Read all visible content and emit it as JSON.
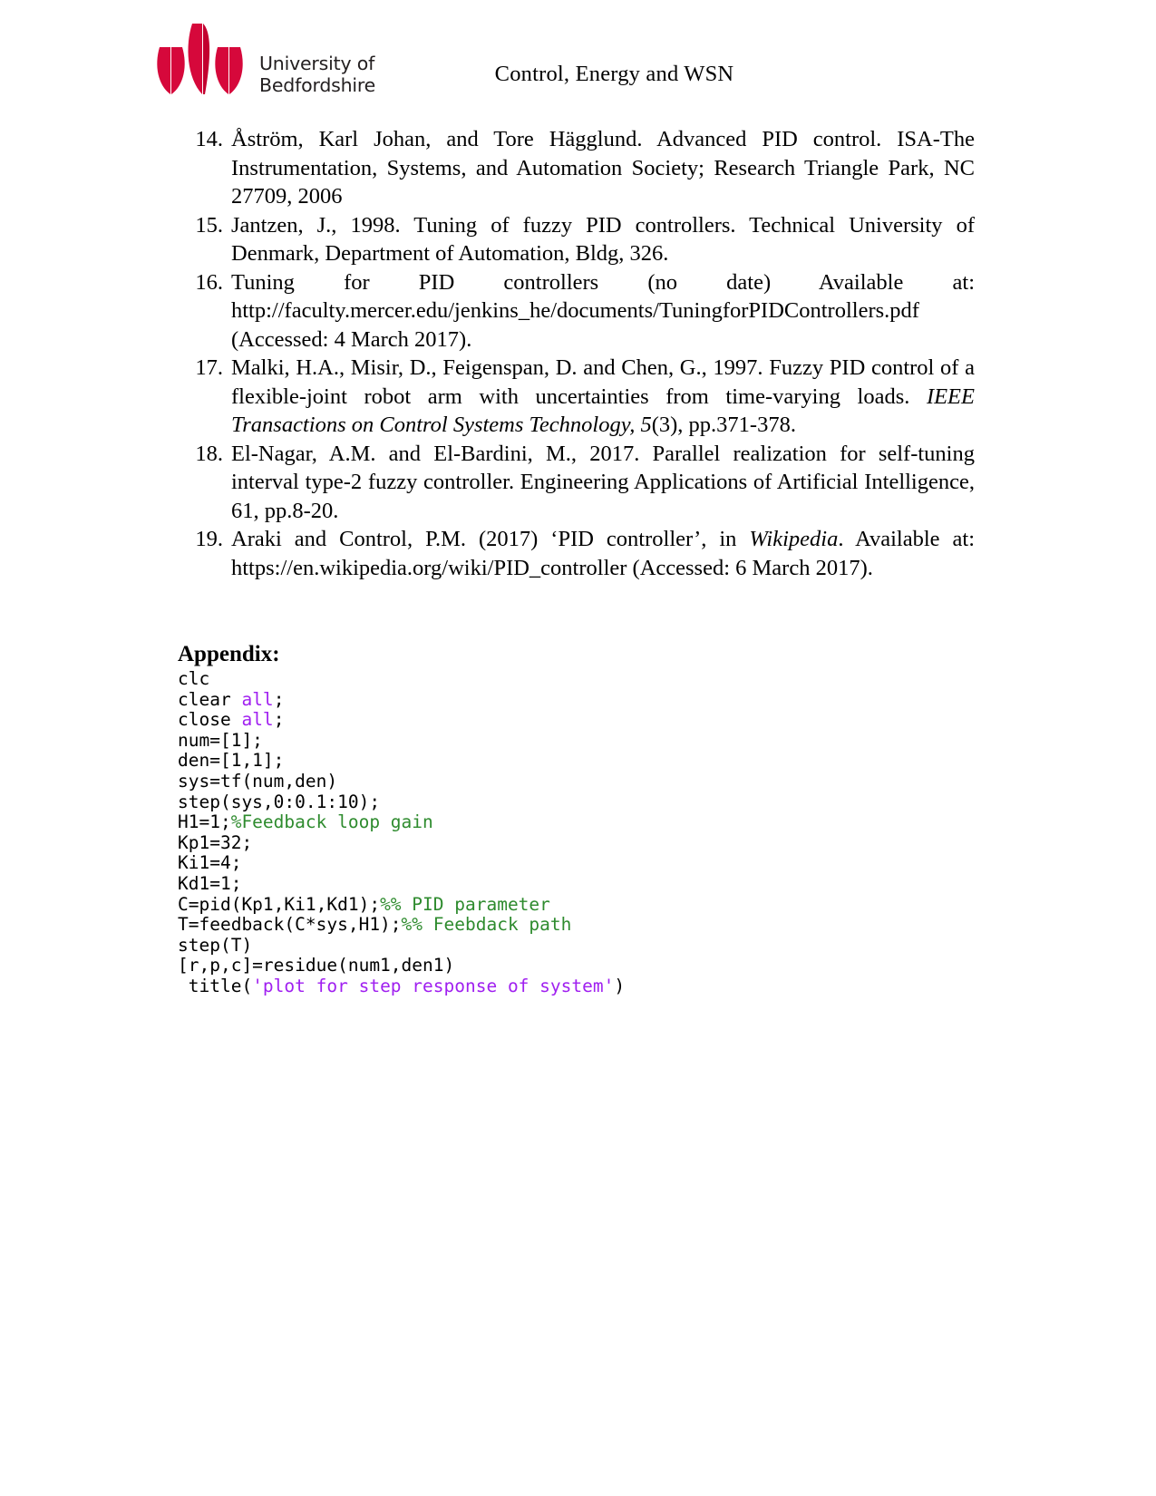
{
  "header": {
    "university_line1": "University of",
    "university_line2": "Bedfordshire",
    "logo_name": "university-of-bedfordshire-logo",
    "brand_color": "#d6083b",
    "document_title": "Control, Energy and WSN"
  },
  "references": [
    {
      "number": "14.",
      "text": "Åström, Karl Johan, and Tore Hägglund. Advanced PID control. ISA-The Instrumentation, Systems, and Automation Society; Research Triangle Park, NC 27709, 2006"
    },
    {
      "number": "15.",
      "text": "Jantzen, J., 1998. Tuning of fuzzy PID controllers. Technical University of Denmark, Department of Automation, Bldg, 326."
    },
    {
      "number": "16.",
      "text": "Tuning for PID controllers (no date) Available at: http://faculty.mercer.edu/jenkins_he/documents/TuningforPIDControllers.pdf (Accessed: 4 March 2017)."
    },
    {
      "number": "17.",
      "text_pre": "Malki, H.A., Misir, D., Feigenspan, D. and Chen, G., 1997. Fuzzy PID control of a flexible-joint robot arm with uncertainties from time-varying loads. ",
      "text_italic": "IEEE Transactions on Control Systems Technology, 5",
      "text_post": "(3), pp.371-378."
    },
    {
      "number": "18.",
      "text": "El-Nagar, A.M. and El-Bardini, M., 2017. Parallel realization for self-tuning interval type-2 fuzzy controller. Engineering Applications of Artificial Intelligence, 61, pp.8-20."
    },
    {
      "number": "19.",
      "text_pre": "Araki and Control, P.M. (2017) ‘PID controller’, in ",
      "text_italic": "Wikipedia",
      "text_post": ". Available at: https://en.wikipedia.org/wiki/PID_controller (Accessed: 6 March 2017)."
    }
  ],
  "appendix": {
    "title": "Appendix:",
    "colors": {
      "keyword": "#a020f0",
      "comment": "#2e8b2e",
      "string": "#a020f0",
      "plain": "#000000"
    },
    "code_lines": [
      [
        {
          "t": "clc",
          "c": "plain"
        }
      ],
      [
        {
          "t": "clear ",
          "c": "plain"
        },
        {
          "t": "all",
          "c": "kw"
        },
        {
          "t": ";",
          "c": "plain"
        }
      ],
      [
        {
          "t": "close ",
          "c": "plain"
        },
        {
          "t": "all",
          "c": "kw"
        },
        {
          "t": ";",
          "c": "plain"
        }
      ],
      [
        {
          "t": "num=[1];",
          "c": "plain"
        }
      ],
      [
        {
          "t": "den=[1,1];",
          "c": "plain"
        }
      ],
      [
        {
          "t": "sys=tf(num,den)",
          "c": "plain"
        }
      ],
      [
        {
          "t": "step(sys,0:0.1:10);",
          "c": "plain"
        }
      ],
      [
        {
          "t": "H1=1;",
          "c": "plain"
        },
        {
          "t": "%Feedback loop gain",
          "c": "cmt"
        }
      ],
      [
        {
          "t": "Kp1=32;",
          "c": "plain"
        }
      ],
      [
        {
          "t": "Ki1=4;",
          "c": "plain"
        }
      ],
      [
        {
          "t": "Kd1=1;",
          "c": "plain"
        }
      ],
      [
        {
          "t": "C=pid(Kp1,Ki1,Kd1);",
          "c": "plain"
        },
        {
          "t": "%% PID parameter",
          "c": "cmt"
        }
      ],
      [
        {
          "t": "T=feedback(C*sys,H1);",
          "c": "plain"
        },
        {
          "t": "%% Feebdack path",
          "c": "cmt"
        }
      ],
      [
        {
          "t": "step(T)",
          "c": "plain"
        }
      ],
      [
        {
          "t": "[r,p,c]=residue(num1,den1)",
          "c": "plain"
        }
      ],
      [
        {
          "t": " title(",
          "c": "plain"
        },
        {
          "t": "'plot for step response of system'",
          "c": "str"
        },
        {
          "t": ")",
          "c": "plain"
        }
      ]
    ]
  }
}
